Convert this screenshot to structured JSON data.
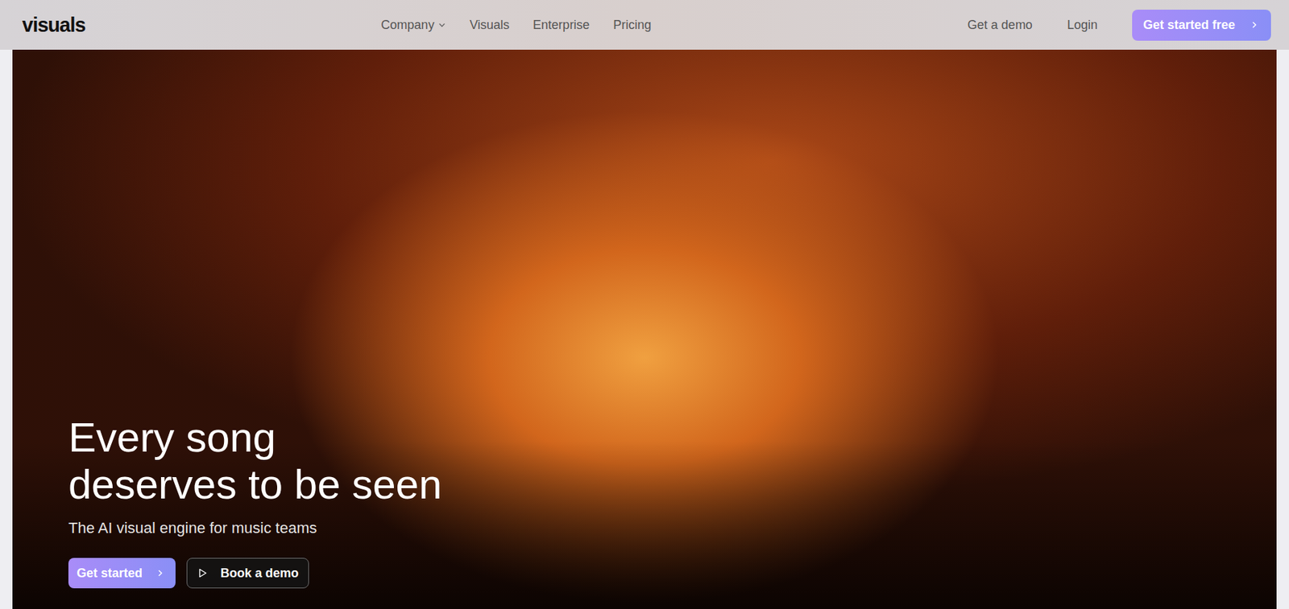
{
  "logo": "visuals",
  "nav": [
    {
      "label": "Company",
      "dropdown": true
    },
    {
      "label": "Visuals",
      "dropdown": false
    },
    {
      "label": "Enterprise",
      "dropdown": false
    },
    {
      "label": "Pricing",
      "dropdown": false
    }
  ],
  "header_actions": {
    "demo": "Get a demo",
    "login": "Login",
    "cta": "Get started free"
  },
  "hero": {
    "title_lines": [
      "Every song",
      "deserves to be seen"
    ],
    "subtitle": "The AI visual engine for music teams",
    "primary": "Get started",
    "secondary": "Book a demo"
  }
}
